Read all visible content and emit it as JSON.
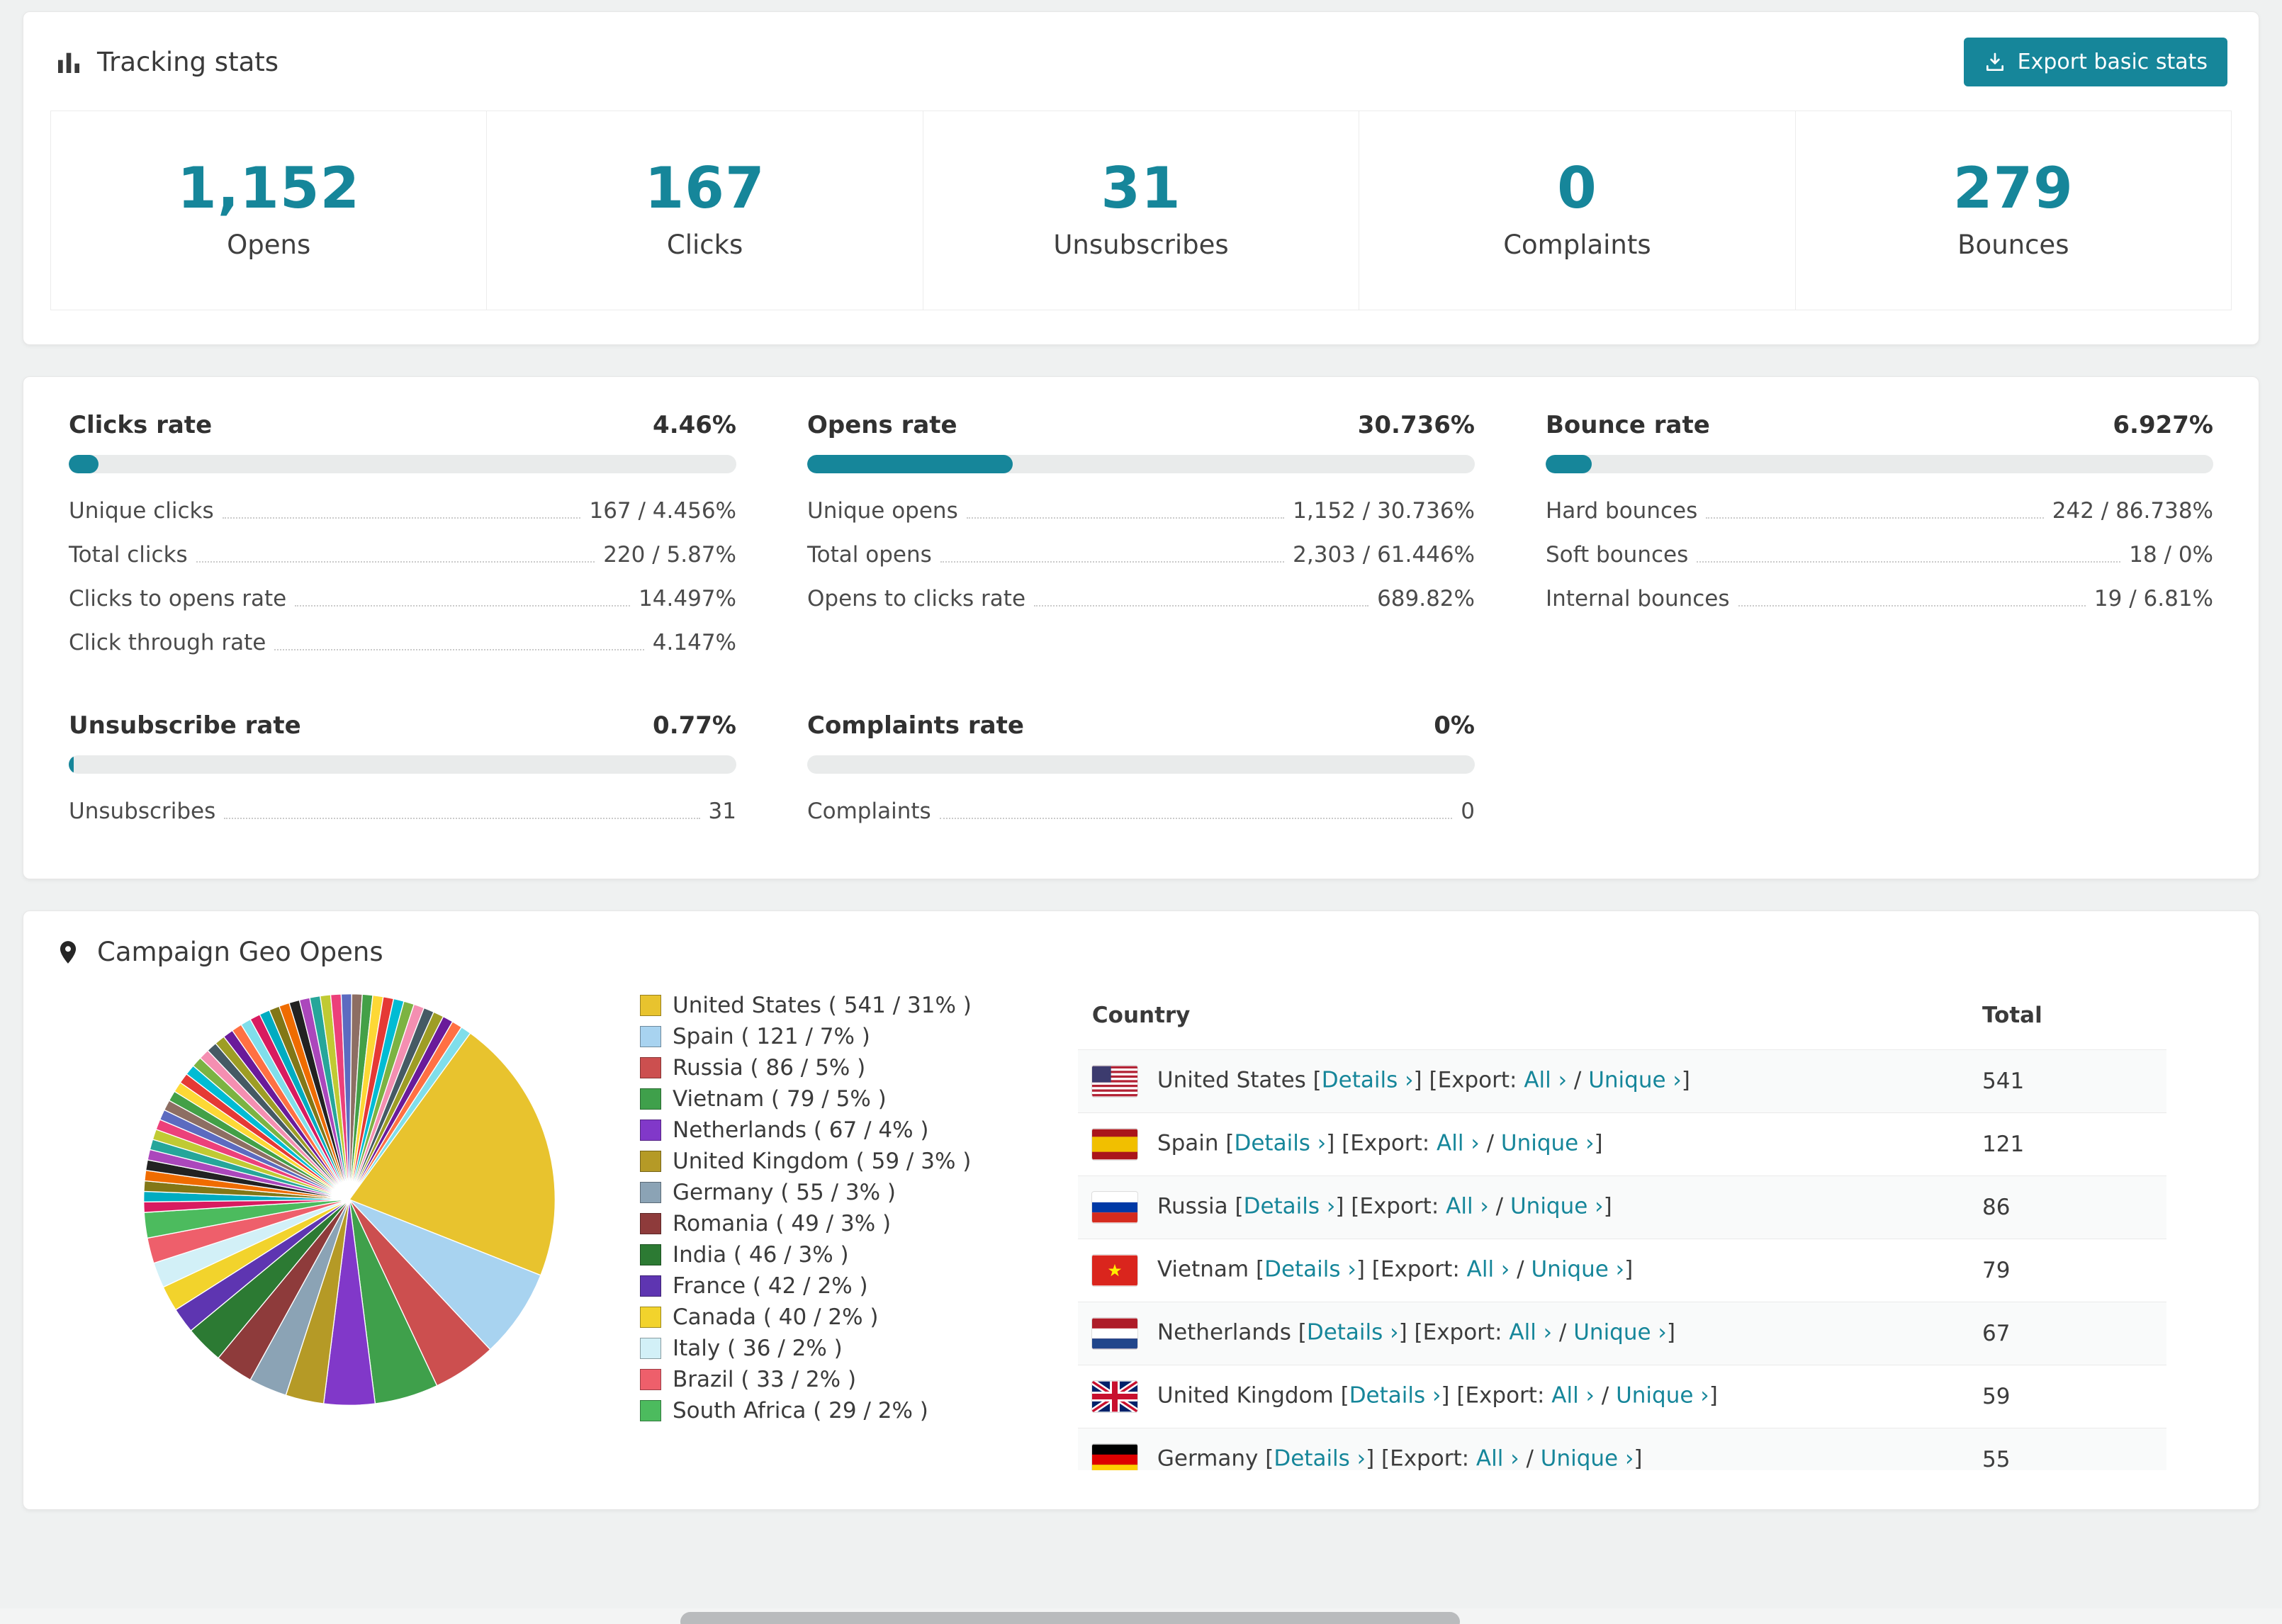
{
  "colors": {
    "accent": "#16869a",
    "link": "#16869a",
    "bar_track": "#e9ebeb"
  },
  "tracking": {
    "title": "Tracking stats",
    "export_button": "Export basic stats",
    "stats": [
      {
        "value": "1,152",
        "label": "Opens"
      },
      {
        "value": "167",
        "label": "Clicks"
      },
      {
        "value": "31",
        "label": "Unsubscribes"
      },
      {
        "value": "0",
        "label": "Complaints"
      },
      {
        "value": "279",
        "label": "Bounces"
      }
    ]
  },
  "rates": {
    "sections": [
      {
        "title": "Clicks rate",
        "value": "4.46%",
        "pct": 4.46,
        "rows": [
          [
            "Unique clicks",
            "167 / 4.456%"
          ],
          [
            "Total clicks",
            "220 / 5.87%"
          ],
          [
            "Clicks to opens rate",
            "14.497%"
          ],
          [
            "Click through rate",
            "4.147%"
          ]
        ]
      },
      {
        "title": "Opens rate",
        "value": "30.736%",
        "pct": 30.736,
        "rows": [
          [
            "Unique opens",
            "1,152 / 30.736%"
          ],
          [
            "Total opens",
            "2,303 / 61.446%"
          ],
          [
            "Opens to clicks rate",
            "689.82%"
          ]
        ]
      },
      {
        "title": "Bounce rate",
        "value": "6.927%",
        "pct": 6.927,
        "rows": [
          [
            "Hard bounces",
            "242 / 86.738%"
          ],
          [
            "Soft bounces",
            "18 / 0%"
          ],
          [
            "Internal bounces",
            "19 / 6.81%"
          ]
        ]
      },
      {
        "title": "Unsubscribe rate",
        "value": "0.77%",
        "pct": 0.77,
        "rows": [
          [
            "Unsubscribes",
            "31"
          ]
        ]
      },
      {
        "title": "Complaints rate",
        "value": "0%",
        "pct": 0,
        "rows": [
          [
            "Complaints",
            "0"
          ]
        ]
      }
    ]
  },
  "geo": {
    "title": "Campaign Geo Opens",
    "chart_data": {
      "type": "pie",
      "title": "Campaign Geo Opens",
      "legend_position": "right",
      "legend_format": "{label} ( {value} / {percent}% )",
      "slices": [
        {
          "label": "United States",
          "value": 541,
          "percent": 31,
          "color": "#e8c32e"
        },
        {
          "label": "Spain",
          "value": 121,
          "percent": 7,
          "color": "#a8d3f0"
        },
        {
          "label": "Russia",
          "value": 86,
          "percent": 5,
          "color": "#cc4f4f"
        },
        {
          "label": "Vietnam",
          "value": 79,
          "percent": 5,
          "color": "#3fa04b"
        },
        {
          "label": "Netherlands",
          "value": 67,
          "percent": 4,
          "color": "#8138c9"
        },
        {
          "label": "United Kingdom",
          "value": 59,
          "percent": 3,
          "color": "#b59a26"
        },
        {
          "label": "Germany",
          "value": 55,
          "percent": 3,
          "color": "#8ba3b5"
        },
        {
          "label": "Romania",
          "value": 49,
          "percent": 3,
          "color": "#8e3b3b"
        },
        {
          "label": "India",
          "value": 46,
          "percent": 3,
          "color": "#2c7a33"
        },
        {
          "label": "France",
          "value": 42,
          "percent": 2,
          "color": "#5e35b1"
        },
        {
          "label": "Canada",
          "value": 40,
          "percent": 2,
          "color": "#f2d32c"
        },
        {
          "label": "Italy",
          "value": 36,
          "percent": 2,
          "color": "#d2f0f7"
        },
        {
          "label": "Brazil",
          "value": 33,
          "percent": 2,
          "color": "#ee5f6b"
        },
        {
          "label": "South Africa",
          "value": 29,
          "percent": 2,
          "color": "#4cbb5e"
        }
      ],
      "others": {
        "percent": 36,
        "slice_count": 44,
        "palette": [
          "#d81b60",
          "#00acc1",
          "#827717",
          "#ef6c00",
          "#222222",
          "#ab47bc",
          "#26a69a",
          "#c0ca33",
          "#ec407a",
          "#5c6bc0",
          "#8d6e63",
          "#43a047",
          "#fdd835",
          "#e53935",
          "#00bcd4",
          "#7cb342",
          "#f48fb1",
          "#455a64",
          "#9e9d24",
          "#6a1b9a",
          "#ff7043",
          "#80deea"
        ]
      }
    },
    "table": {
      "headers": [
        "Country",
        "Total"
      ],
      "link_labels": {
        "details": "Details ›",
        "export": "Export:",
        "all": "All ›",
        "unique": "Unique ›"
      },
      "rows": [
        {
          "country": "United States",
          "flag": "us",
          "total": "541"
        },
        {
          "country": "Spain",
          "flag": "es",
          "total": "121"
        },
        {
          "country": "Russia",
          "flag": "ru",
          "total": "86"
        },
        {
          "country": "Vietnam",
          "flag": "vn",
          "total": "79"
        },
        {
          "country": "Netherlands",
          "flag": "nl",
          "total": "67"
        },
        {
          "country": "United Kingdom",
          "flag": "gb",
          "total": "59"
        },
        {
          "country": "Germany",
          "flag": "de",
          "total": "55"
        }
      ]
    }
  }
}
